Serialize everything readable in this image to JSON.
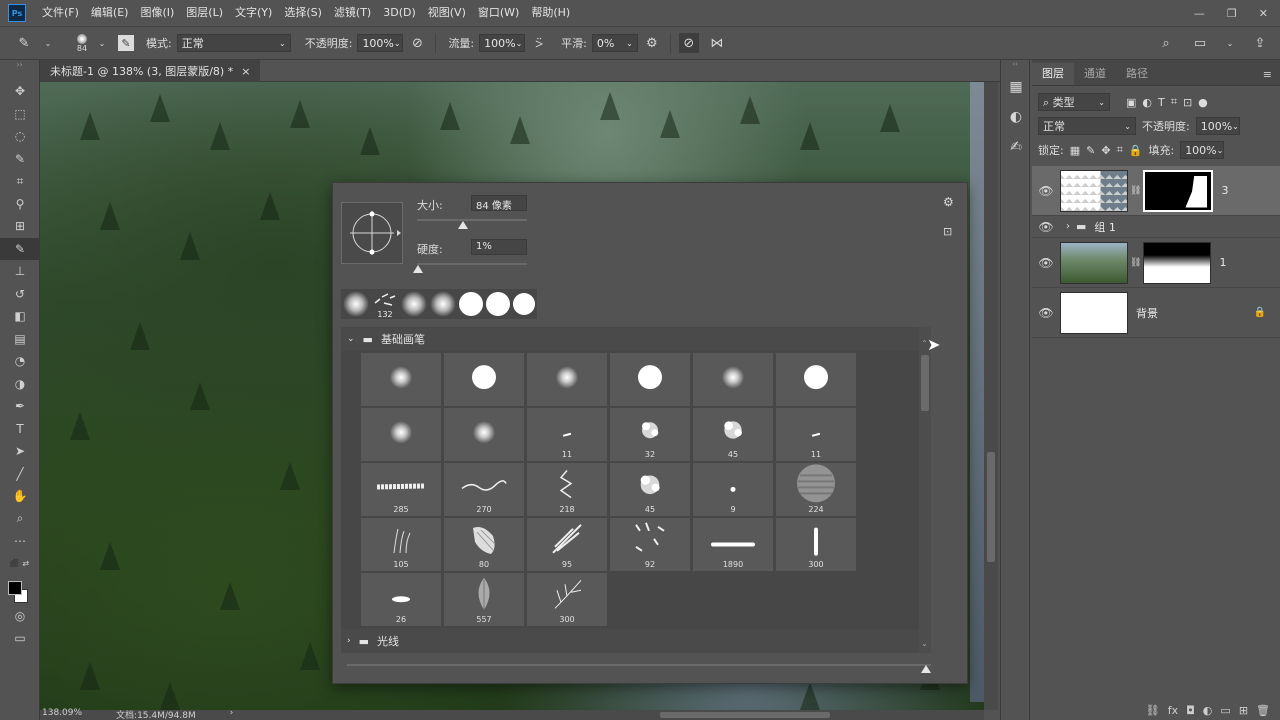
{
  "menubar": {
    "logo": "Ps",
    "items": [
      "文件(F)",
      "编辑(E)",
      "图像(I)",
      "图层(L)",
      "文字(Y)",
      "选择(S)",
      "滤镜(T)",
      "3D(D)",
      "视图(V)",
      "窗口(W)",
      "帮助(H)"
    ],
    "window_controls": [
      "—",
      "❐",
      "✕"
    ]
  },
  "options": {
    "brush_size": "84",
    "mode_label": "模式:",
    "mode_value": "正常",
    "opacity_label": "不透明度:",
    "opacity_value": "100%",
    "flow_label": "流量:",
    "flow_value": "100%",
    "smooth_label": "平滑:",
    "smooth_value": "0%"
  },
  "document": {
    "tab_title": "未标题-1 @ 138% (3, 图层蒙版/8) *",
    "close": "×",
    "zoom": "138.09%",
    "doc_size": "文档:15.4M/94.8M",
    "status_arrow": "›"
  },
  "tools": [
    {
      "name": "move-tool",
      "glyph": "✥"
    },
    {
      "name": "marquee-tool",
      "glyph": "⬚"
    },
    {
      "name": "lasso-tool",
      "glyph": "◌"
    },
    {
      "name": "quick-select-tool",
      "glyph": "✎"
    },
    {
      "name": "crop-tool",
      "glyph": "⌗"
    },
    {
      "name": "eyedropper-tool",
      "glyph": "⚲"
    },
    {
      "name": "healing-tool",
      "glyph": "⊞"
    },
    {
      "name": "brush-tool",
      "glyph": "✎"
    },
    {
      "name": "stamp-tool",
      "glyph": "⊥"
    },
    {
      "name": "history-brush-tool",
      "glyph": "↺"
    },
    {
      "name": "eraser-tool",
      "glyph": "◧"
    },
    {
      "name": "gradient-tool",
      "glyph": "▤"
    },
    {
      "name": "blur-tool",
      "glyph": "◔"
    },
    {
      "name": "dodge-tool",
      "glyph": "◑"
    },
    {
      "name": "pen-tool",
      "glyph": "✒"
    },
    {
      "name": "type-tool",
      "glyph": "T"
    },
    {
      "name": "path-select-tool",
      "glyph": "➤"
    },
    {
      "name": "line-tool",
      "glyph": "╱"
    },
    {
      "name": "hand-tool",
      "glyph": "✋"
    },
    {
      "name": "zoom-tool",
      "glyph": "⌕"
    },
    {
      "name": "more-tools",
      "glyph": "⋯"
    }
  ],
  "picker": {
    "size_label": "大小:",
    "size_value": "84 像素",
    "hardness_label": "硬度:",
    "hardness_value": "1%",
    "size_level": 0.42,
    "hardness_level": 0.01,
    "recent_count": "132",
    "folder_open": "基础画笔",
    "folder_closed": "光线",
    "tiles": [
      {
        "kind": "soft",
        "d": 22,
        "num": ""
      },
      {
        "kind": "hard",
        "d": 24,
        "num": ""
      },
      {
        "kind": "soft",
        "d": 22,
        "num": ""
      },
      {
        "kind": "hard",
        "d": 24,
        "num": ""
      },
      {
        "kind": "soft",
        "d": 22,
        "num": ""
      },
      {
        "kind": "hard",
        "d": 24,
        "num": ""
      },
      {
        "kind": "soft",
        "d": 22,
        "num": ""
      },
      {
        "kind": "soft",
        "d": 22,
        "num": ""
      },
      {
        "kind": "dash",
        "d": 8,
        "num": "11"
      },
      {
        "kind": "splat",
        "d": 24,
        "num": "32"
      },
      {
        "kind": "splat",
        "d": 26,
        "num": "45"
      },
      {
        "kind": "dash",
        "d": 8,
        "num": "11"
      },
      {
        "kind": "stroke",
        "d": 50,
        "num": "285"
      },
      {
        "kind": "wave",
        "d": 46,
        "num": "270"
      },
      {
        "kind": "zigzag",
        "d": 30,
        "num": "218"
      },
      {
        "kind": "splat",
        "d": 28,
        "num": "45"
      },
      {
        "kind": "dot",
        "d": 5,
        "num": "9"
      },
      {
        "kind": "lines",
        "d": 40,
        "num": "224"
      },
      {
        "kind": "grass",
        "d": 26,
        "num": "105"
      },
      {
        "kind": "chalk",
        "d": 34,
        "num": "80"
      },
      {
        "kind": "leafy",
        "d": 36,
        "num": "95"
      },
      {
        "kind": "bits",
        "d": 36,
        "num": "92"
      },
      {
        "kind": "bar",
        "d": 44,
        "num": "1890"
      },
      {
        "kind": "vbar",
        "d": 28,
        "num": "300"
      },
      {
        "kind": "ellipse",
        "d": 18,
        "num": "26"
      },
      {
        "kind": "leaf",
        "d": 26,
        "num": "557"
      },
      {
        "kind": "fern",
        "d": 32,
        "num": "300"
      }
    ]
  },
  "layers_panel": {
    "tabs": [
      "图层",
      "通道",
      "路径"
    ],
    "filter_label": "类型",
    "blend_mode": "正常",
    "opacity_label": "不透明度:",
    "opacity_value": "100%",
    "lock_label": "锁定:",
    "fill_label": "填充:",
    "fill_value": "100%",
    "layers": [
      {
        "name": "3",
        "type": "layer-with-mask",
        "selected": true
      },
      {
        "name": "组 1",
        "type": "group",
        "selected": false
      },
      {
        "name": "1",
        "type": "photo-with-mask",
        "selected": false
      },
      {
        "name": "背景",
        "type": "background",
        "selected": false
      }
    ],
    "footer_icons": [
      "link-icon",
      "fx-icon",
      "mask-icon",
      "adjustment-icon",
      "folder-icon",
      "new-layer-icon",
      "trash-icon"
    ],
    "footer_glyphs": [
      "⛓",
      "fx",
      "◘",
      "◐",
      "▭",
      "⊞",
      "🗑"
    ]
  }
}
